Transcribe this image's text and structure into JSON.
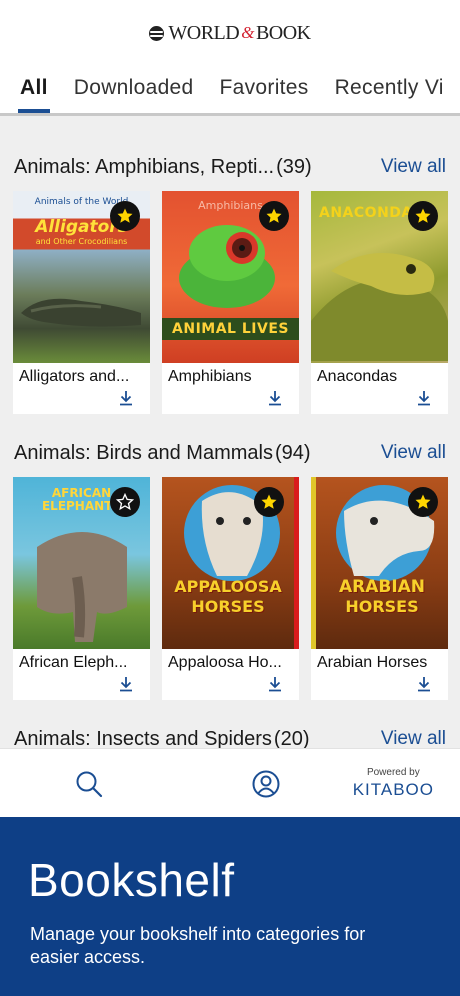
{
  "header": {
    "logo_left": "WORLD",
    "logo_amp": "&",
    "logo_right": "BOOK"
  },
  "tabs": [
    {
      "label": "All",
      "active": true
    },
    {
      "label": "Downloaded",
      "active": false
    },
    {
      "label": "Favorites",
      "active": false
    },
    {
      "label": "Recently Vi",
      "active": false
    }
  ],
  "sections": [
    {
      "title": "Animals: Amphibians, Repti...",
      "count": "(39)",
      "view_all": "View all",
      "books": [
        {
          "title": "Alligators and...",
          "favorite": true,
          "cover_text": "Alligators",
          "cover_sub": "and Other Crocodilians",
          "cover_top": "Animals of the World"
        },
        {
          "title": "Amphibians",
          "favorite": true,
          "cover_text": "ANIMAL LIVES",
          "cover_top": "Amphibians"
        },
        {
          "title": "Anacondas",
          "favorite": true,
          "cover_text": "ANACONDAS"
        }
      ]
    },
    {
      "title": "Animals: Birds and Mammals",
      "count": "(94)",
      "view_all": "View all",
      "books": [
        {
          "title": "African Eleph...",
          "favorite": false,
          "cover_text": "AFRICAN ELEPHANTS"
        },
        {
          "title": "Appaloosa Ho...",
          "favorite": true,
          "cover_text": "APPALOOSA",
          "cover_sub": "HORSES"
        },
        {
          "title": "Arabian Horses",
          "favorite": true,
          "cover_text": "ARABIAN",
          "cover_sub": "HORSES"
        }
      ]
    },
    {
      "title": "Animals: Insects and Spiders",
      "count": "(20)",
      "view_all": "View all"
    }
  ],
  "bottom_nav": {
    "search_icon": "search-icon",
    "profile_icon": "profile-icon",
    "powered_by": "Powered by",
    "brand": "KITABOO"
  },
  "promo": {
    "title": "Bookshelf",
    "description": "Manage your bookshelf into categories for easier access."
  },
  "colors": {
    "accent": "#1b4e93",
    "promo_bg": "#0e3f86",
    "shelf_bg": "#efefef",
    "star": "#ffd500"
  }
}
